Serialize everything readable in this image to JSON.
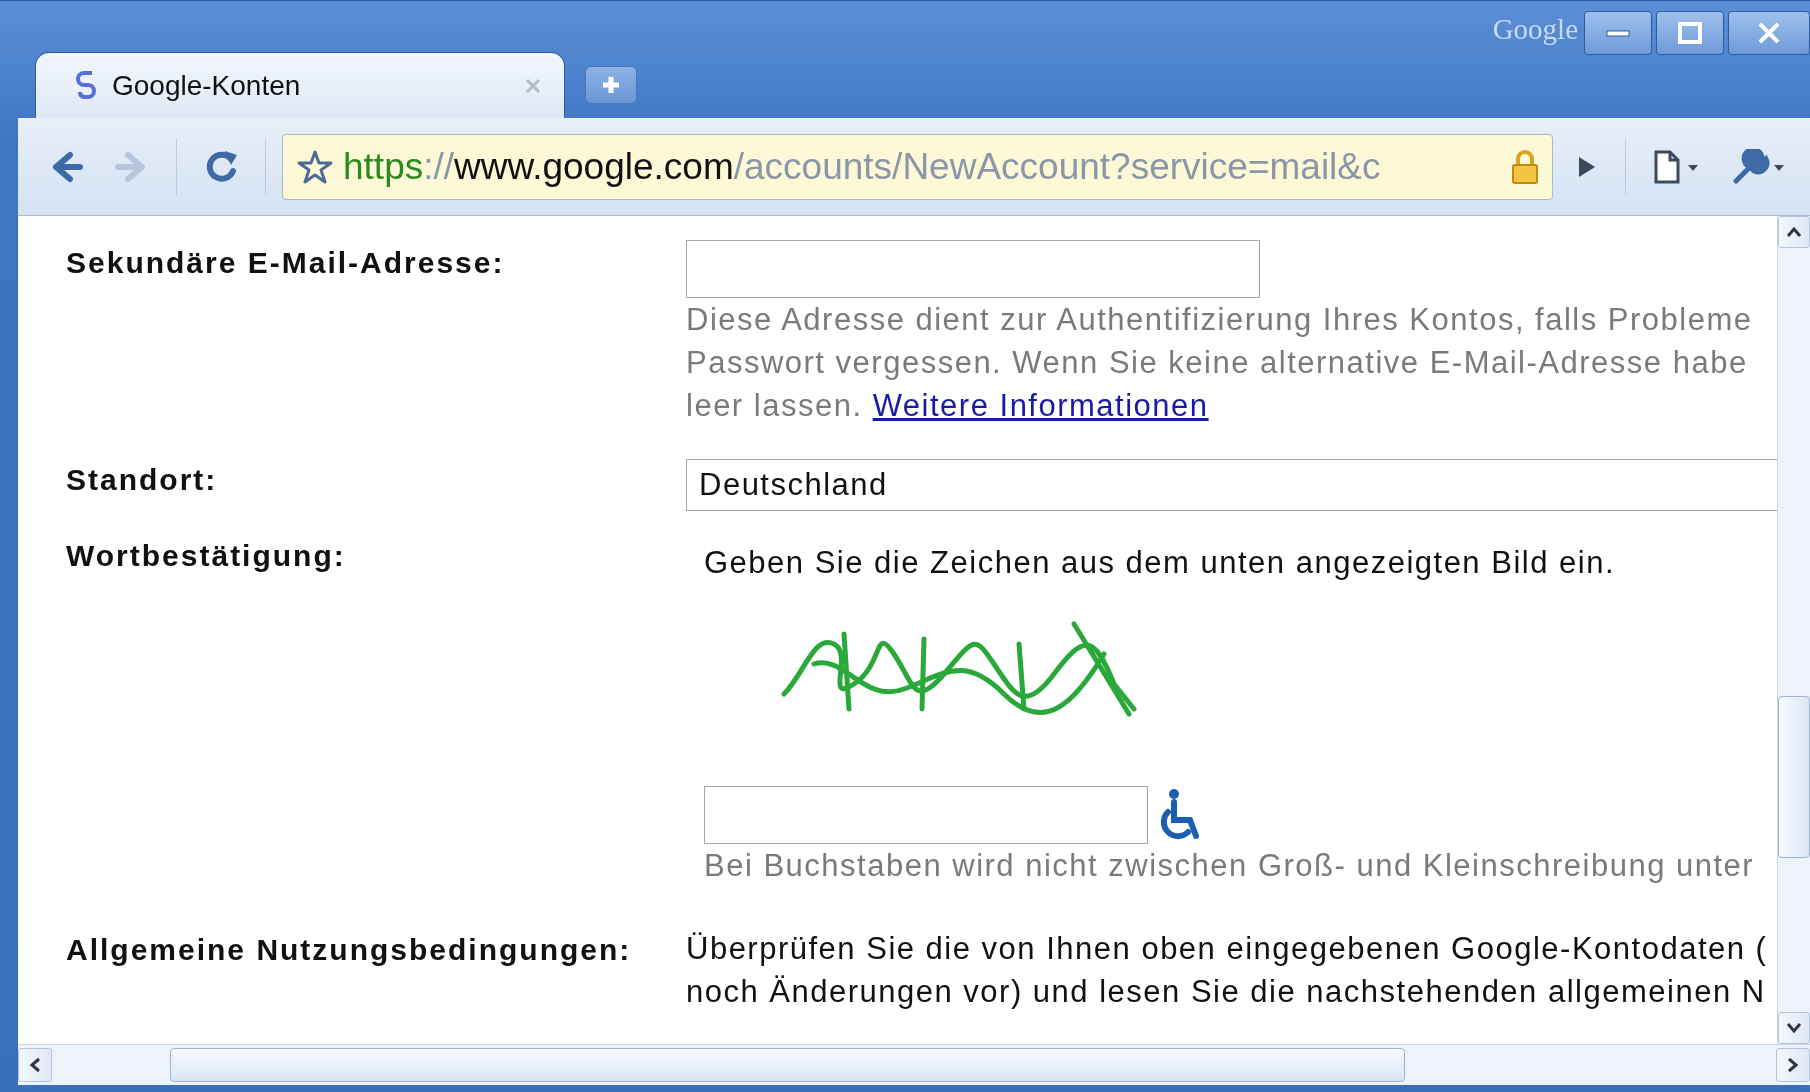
{
  "window": {
    "brand": "Google"
  },
  "tabs": [
    {
      "title": "Google-Konten",
      "selected": true
    }
  ],
  "nav": [
    {
      "kind": "back",
      "disabled": false
    },
    {
      "kind": "forward",
      "disabled": true
    },
    {
      "kind": "reload",
      "disabled": false
    }
  ],
  "address_bar": {
    "scheme": "https",
    "separator": "://",
    "host": "www.google.com",
    "path": "/accounts/NewAccount?service=mail&c",
    "secure": true
  },
  "form": {
    "rows": [
      {
        "kind": "email",
        "label": "Sekundäre E-Mail-Adresse:",
        "hint_lines": [
          "Diese Adresse dient zur Authentifizierung Ihres Kontos, falls Probleme",
          "Passwort vergessen. Wenn Sie keine alternative E-Mail-Adresse habe"
        ],
        "hint_tail": "leer lassen.",
        "link": "Weitere Informationen"
      },
      {
        "kind": "select",
        "label": "Standort:",
        "value": "Deutschland"
      },
      {
        "kind": "captcha",
        "label": "Wortbestätigung:",
        "instruction": "Geben Sie die Zeichen aus dem unten angezeigten Bild ein.",
        "hint": "Bei Buchstaben wird nicht zwischen Groß- und Kleinschreibung unter"
      },
      {
        "kind": "terms",
        "label": "Allgemeine Nutzungsbedingungen:",
        "lines": [
          "Überprüfen Sie die von Ihnen oben eingegebenen Google-Kontodaten (",
          "noch Änderungen vor) und lesen Sie die nachstehenden allgemeinen N"
        ]
      }
    ]
  }
}
